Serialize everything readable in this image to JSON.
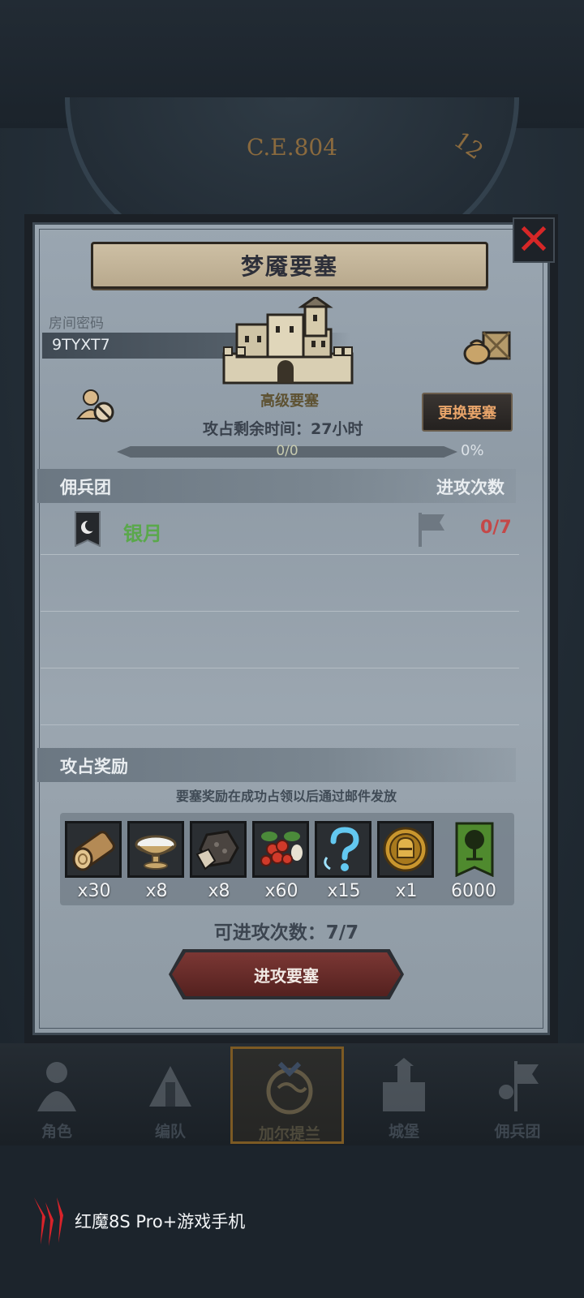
{
  "background": {
    "year": "C.E.804",
    "dial_number": "12"
  },
  "dialog": {
    "title": "梦魇要塞",
    "room_code_label": "房间密码",
    "room_code": "9TYXT7",
    "fortress_level": "高级要塞",
    "change_button": "更换要塞",
    "time_remaining": "攻占剩余时间：27小时",
    "progress": {
      "count_text": "0/0",
      "percent_text": "0%",
      "fraction": 0
    },
    "guild_header": "佣兵团",
    "attacks_header": "进攻次数",
    "guild": {
      "name": "银月",
      "attack_count": "0/7"
    },
    "reward_header": "攻占奖励",
    "reward_note": "要塞奖励在成功占领以后通过邮件发放",
    "rewards": [
      {
        "icon": "wood-log-icon",
        "count": "x30"
      },
      {
        "icon": "cream-bowl-icon",
        "count": "x8"
      },
      {
        "icon": "ore-icon",
        "count": "x8"
      },
      {
        "icon": "berries-icon",
        "count": "x60"
      },
      {
        "icon": "mystery-question-icon",
        "count": "x15"
      },
      {
        "icon": "knight-medal-icon",
        "count": "x1"
      },
      {
        "icon": "tree-banner-icon",
        "count": "6000"
      }
    ],
    "attempts": "可进攻次数：7/7",
    "attack_button": "进攻要塞"
  },
  "nav": [
    {
      "label": "角色",
      "icon": "character-icon"
    },
    {
      "label": "编队",
      "icon": "formation-icon"
    },
    {
      "label": "加尔提兰",
      "icon": "world-icon"
    },
    {
      "label": "城堡",
      "icon": "castle-icon"
    },
    {
      "label": "佣兵团",
      "icon": "mercenary-icon"
    }
  ],
  "watermark": "红魔8S Pro+游戏手机",
  "colors": {
    "guild_green": "#5aa84b",
    "count_red": "#c44848",
    "change_button_text": "#e9a56a"
  }
}
